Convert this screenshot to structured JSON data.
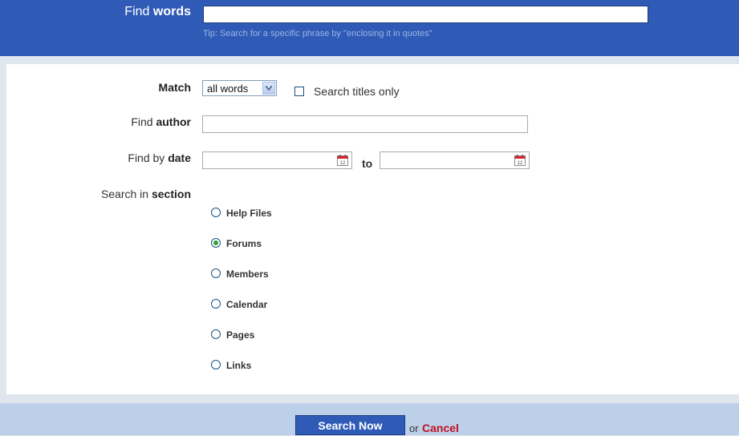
{
  "find_words": {
    "label_prefix": "Find",
    "label_bold": "words",
    "value": "",
    "placeholder": "",
    "tip": "Tip: Search for a specific phrase by \"enclosing it in quotes\""
  },
  "match": {
    "label": "Match",
    "selected": "all words",
    "search_titles_label": "Search titles only",
    "search_titles_checked": false
  },
  "author": {
    "label_prefix": "Find",
    "label_bold": "author",
    "value": ""
  },
  "date": {
    "label_prefix": "Find by",
    "label_bold": "date",
    "from_value": "",
    "to_label": "to",
    "to_value": ""
  },
  "section": {
    "label_prefix": "Search in",
    "label_bold": "section",
    "options": [
      "Help Files",
      "Forums",
      "Members",
      "Calendar",
      "Pages",
      "Links"
    ],
    "selected": "Forums"
  },
  "footer": {
    "search_button": "Search Now",
    "or_text": "or",
    "cancel_link": "Cancel"
  },
  "icons": {
    "calendar": "calendar-icon",
    "dropdown": "chevron-down-icon"
  },
  "colors": {
    "header_blue": "#2f5bb7",
    "cancel_red": "#c01020",
    "selected_radio": "#2fa236"
  }
}
